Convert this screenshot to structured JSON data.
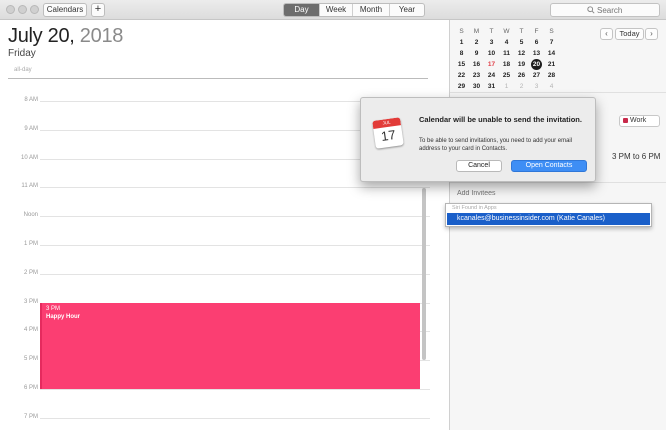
{
  "toolbar": {
    "calendars_label": "Calendars",
    "add_label": "+",
    "views": [
      "Day",
      "Week",
      "Month",
      "Year"
    ],
    "active_view": "Day",
    "search_placeholder": "Search"
  },
  "day_view": {
    "date_main": "July 20,",
    "date_year": "2018",
    "weekday": "Friday",
    "all_day_label": "all-day",
    "hours": [
      "8 AM",
      "9 AM",
      "10 AM",
      "11 AM",
      "Noon",
      "1 PM",
      "2 PM",
      "3 PM",
      "4 PM",
      "5 PM",
      "6 PM",
      "7 PM"
    ],
    "event": {
      "time": "3 PM",
      "name": "Happy Hour",
      "color": "#fb3e72"
    }
  },
  "mini_calendar": {
    "weekday_headers": [
      "S",
      "M",
      "T",
      "W",
      "T",
      "F",
      "S"
    ],
    "weeks": [
      [
        "1",
        "2",
        "3",
        "4",
        "5",
        "6",
        "7"
      ],
      [
        "8",
        "9",
        "10",
        "11",
        "12",
        "13",
        "14"
      ],
      [
        "15",
        "16",
        "17",
        "18",
        "19",
        "20",
        "21"
      ],
      [
        "22",
        "23",
        "24",
        "25",
        "26",
        "27",
        "28"
      ],
      [
        "29",
        "30",
        "31",
        "1",
        "2",
        "3",
        "4"
      ]
    ],
    "selected_day": "20",
    "today_label": "Today",
    "prev_label": "‹",
    "next_label": "›"
  },
  "event_detail": {
    "calendar_name": "Work",
    "calendar_color": "#c8294a",
    "time_range": "3 PM to 6 PM",
    "add_invitees_placeholder": "Add Invitees",
    "suggestion_header": "Siri Found in Apps",
    "suggestion": "kcanales@businessinsider.com (Katie Canales)"
  },
  "dialog": {
    "icon_month": "JUL",
    "icon_day": "17",
    "title": "Calendar will be unable to send the invitation.",
    "message": "To be able to send invitations, you need to add your email address to your card in Contacts.",
    "cancel_label": "Cancel",
    "open_contacts_label": "Open Contacts"
  }
}
